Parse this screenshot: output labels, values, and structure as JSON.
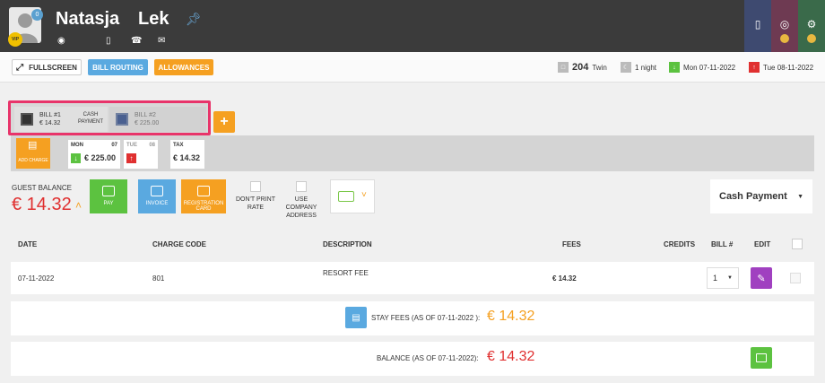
{
  "guest": {
    "first_name": "Natasja",
    "last_name": "Lek",
    "notif_count": "0",
    "vip": "VIP"
  },
  "toolbar": {
    "fullscreen": "FULLSCREEN",
    "bill_routing": "BILL ROUTING",
    "allowances": "ALLOWANCES"
  },
  "stay": {
    "room": "204",
    "room_type": "Twin",
    "nights": "1 night",
    "arrival": "Mon 07-11-2022",
    "departure": "Tue 08-11-2022"
  },
  "bills": {
    "bill1": {
      "name": "BILL #1",
      "amount": "€ 14.32",
      "payment": "CASH PAYMENT"
    },
    "bill2": {
      "name": "BILL #2",
      "amount": "€ 225.00"
    },
    "add": "+"
  },
  "charges": {
    "add_charge": "ADD CHARGE",
    "mon": {
      "day": "MON",
      "date": "07",
      "value": "€ 225.00"
    },
    "tue": {
      "day": "TUE",
      "date": "08"
    },
    "tax": {
      "day": "TAX",
      "value": "€ 14.32"
    }
  },
  "balance": {
    "label": "GUEST BALANCE",
    "amount": "€ 14.32",
    "pay": "PAY",
    "invoice": "INVOICE",
    "registration": "REGISTRATION CARD",
    "dont_print": "DON'T PRINT RATE",
    "use_company": "USE COMPANY ADDRESS",
    "payment_method": "Cash Payment"
  },
  "table": {
    "headers": {
      "date": "DATE",
      "code": "CHARGE CODE",
      "desc": "DESCRIPTION",
      "fees": "FEES",
      "credits": "CREDITS",
      "bill": "BILL #",
      "edit": "EDIT"
    },
    "row": {
      "date": "07-11-2022",
      "code": "801",
      "desc": "RESORT FEE",
      "fees": "€ 14.32",
      "bill": "1"
    }
  },
  "summary": {
    "stay_fees_label": "STAY FEES (AS OF  07-11-2022 ):",
    "stay_fees_value": "€ 14.32",
    "balance_label": "BALANCE (AS OF  07-11-2022):",
    "balance_value": "€ 14.32"
  },
  "colors": {
    "orange": "#f5a021",
    "blue": "#5aa9e0",
    "green": "#5cc240",
    "red": "#e03030",
    "highlight": "#e8346a",
    "purple": "#a040c0"
  }
}
